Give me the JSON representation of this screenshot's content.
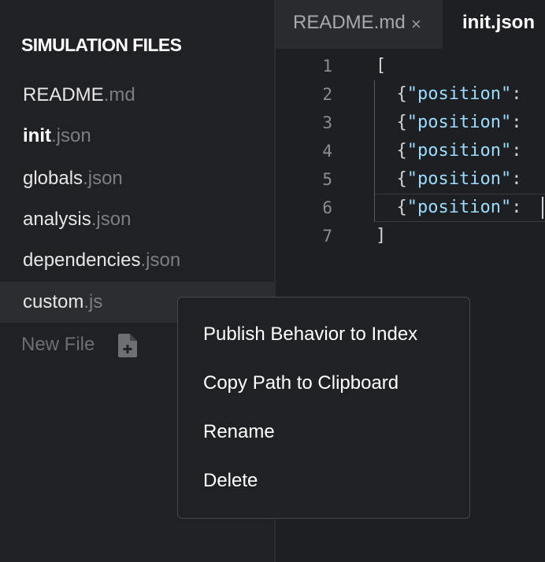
{
  "sidebar": {
    "title": "SIMULATION FILES",
    "files": [
      {
        "base": "README",
        "ext": ".md"
      },
      {
        "base": "init",
        "ext": ".json"
      },
      {
        "base": "globals",
        "ext": ".json"
      },
      {
        "base": "analysis",
        "ext": ".json"
      },
      {
        "base": "dependencies",
        "ext": ".json"
      },
      {
        "base": "custom",
        "ext": ".js"
      }
    ],
    "new_file_label": "New File",
    "new_file_icon": "file-plus-icon"
  },
  "tabs": [
    {
      "label": "README.md",
      "close": "×"
    },
    {
      "label": "init.json"
    }
  ],
  "editor": {
    "lines": [
      {
        "num": "1",
        "pre": "[",
        "key": "",
        "post": ""
      },
      {
        "num": "2",
        "pre": "  {",
        "key": "\"position\"",
        "post": ":"
      },
      {
        "num": "3",
        "pre": "  {",
        "key": "\"position\"",
        "post": ":"
      },
      {
        "num": "4",
        "pre": "  {",
        "key": "\"position\"",
        "post": ":"
      },
      {
        "num": "5",
        "pre": "  {",
        "key": "\"position\"",
        "post": ":"
      },
      {
        "num": "6",
        "pre": "  {",
        "key": "\"position\"",
        "post": ":"
      },
      {
        "num": "7",
        "pre": "]",
        "key": "",
        "post": ""
      }
    ]
  },
  "context_menu": {
    "items": [
      "Publish Behavior to Index",
      "Copy Path to Clipboard",
      "Rename",
      "Delete"
    ]
  },
  "colors": {
    "background": "#202124",
    "editor_background": "#1e1f22",
    "json_key": "#9cdcfe"
  }
}
